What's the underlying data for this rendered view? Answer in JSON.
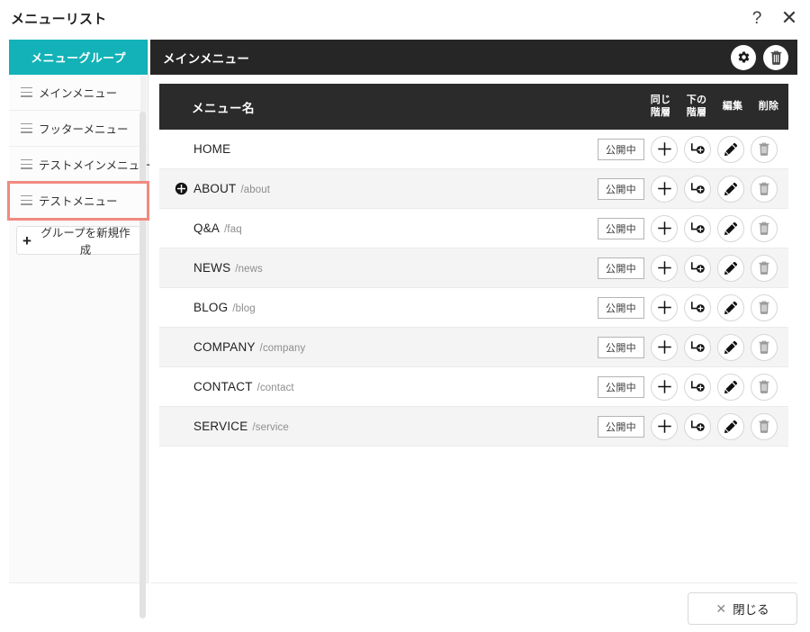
{
  "window": {
    "title": "メニューリスト",
    "help_icon": "question-mark-icon",
    "close_icon": "close-x-icon"
  },
  "sidebar": {
    "header": "メニューグループ",
    "items": [
      {
        "label": "メインメニュー",
        "selected": false,
        "icon": "hamburger-handle-icon"
      },
      {
        "label": "フッターメニュー",
        "selected": false,
        "icon": "hamburger-handle-icon"
      },
      {
        "label": "テストメインメニュー",
        "selected": false,
        "icon": "hamburger-handle-icon"
      },
      {
        "label": "テストメニュー",
        "selected": true,
        "icon": "hamburger-handle-icon"
      }
    ],
    "new_group_button": "グループを新規作成",
    "new_group_icon": "plus-icon",
    "selected_outline_color": "#f08a80",
    "header_color": "#12b2b8"
  },
  "main": {
    "header_title": "メインメニュー",
    "header_bg": "#262626",
    "actions": [
      {
        "name": "settings-button",
        "icon": "gear-icon"
      },
      {
        "name": "delete-group-button",
        "icon": "trash-icon"
      }
    ],
    "table": {
      "columns": {
        "name": "メニュー名",
        "same_level": [
          "同じ",
          "階層"
        ],
        "sub_level": [
          "下の",
          "階層"
        ],
        "edit": "編集",
        "delete": "削除"
      },
      "rows": [
        {
          "title": "HOME",
          "path": "",
          "status": "公開中",
          "expandable": false
        },
        {
          "title": "ABOUT",
          "path": "/about",
          "status": "公開中",
          "expandable": true
        },
        {
          "title": "Q&A",
          "path": "/faq",
          "status": "公開中",
          "expandable": false
        },
        {
          "title": "NEWS",
          "path": "/news",
          "status": "公開中",
          "expandable": false
        },
        {
          "title": "BLOG",
          "path": "/blog",
          "status": "公開中",
          "expandable": false
        },
        {
          "title": "COMPANY",
          "path": "/company",
          "status": "公開中",
          "expandable": false
        },
        {
          "title": "CONTACT",
          "path": "/contact",
          "status": "公開中",
          "expandable": false
        },
        {
          "title": "SERVICE",
          "path": "/service",
          "status": "公開中",
          "expandable": false
        }
      ],
      "row_icons": {
        "add_same_level": "plus-icon",
        "add_sub_level": "add-child-level-icon",
        "edit": "pencil-icon",
        "delete": "trash-icon"
      }
    }
  },
  "footer": {
    "close_button_label": "閉じる",
    "close_button_icon": "close-x-icon"
  }
}
